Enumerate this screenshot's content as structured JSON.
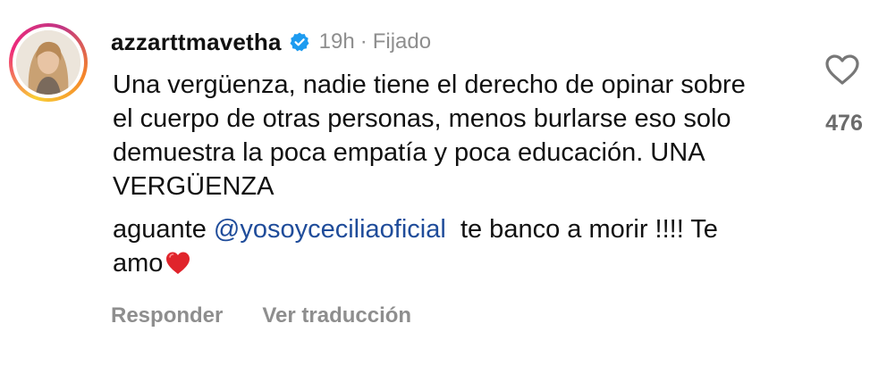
{
  "comment": {
    "username": "azzarttmavetha",
    "verified": true,
    "time": "19h",
    "separator": "·",
    "pinned_label": "Fijado",
    "text_paragraph_1": "Una vergüenza, nadie tiene el derecho de opinar sobre el cuerpo de otras personas, menos burlarse eso solo demuestra la poca empatía y poca educación. UNA VERGÜENZA",
    "text_paragraph_2_before": "aguante ",
    "mention": "@yosoyceciliaoficial",
    "text_paragraph_2_after": "  te banco a morir !!!! Te amo",
    "emoji": "red-heart",
    "like_count": "476"
  },
  "actions": {
    "reply_label": "Responder",
    "translate_label": "Ver traducción"
  },
  "colors": {
    "mention": "#1f4c9a",
    "verified_badge": "#1d9bf0",
    "meta_gray": "#8e8e8e",
    "heart_red": "#e0242b"
  },
  "icons": {
    "like": "heart-outline-icon",
    "verified": "verified-badge-icon"
  }
}
